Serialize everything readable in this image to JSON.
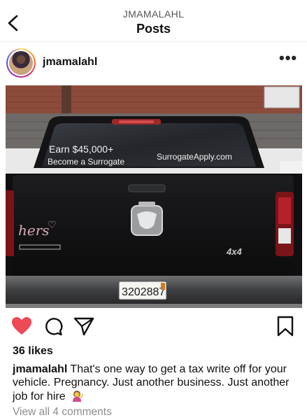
{
  "header": {
    "account_label": "JMAMALAHL",
    "title": "Posts"
  },
  "post": {
    "username": "jmamalahl",
    "more_label": "•••",
    "image": {
      "window_text_line1": "Earn $45,000+",
      "window_text_line2": "Become a Surrogate",
      "window_text_url": "SurrogateApply.com",
      "decal_script": "hers",
      "badge_text": "4x4",
      "plate_text": "3202887"
    },
    "likes": "36 likes",
    "caption_username": "jmamalahl",
    "caption_text": "That's one way to get a tax write off for your vehicle. Pregnancy. Just another business. Just another job for hire",
    "caption_emoji": "woman-tipping-hand-emoji",
    "view_comments": "View all 4 comments"
  },
  "icons": {
    "back": "chevron-left-icon",
    "like": "heart-filled-icon",
    "comment": "comment-bubble-icon",
    "share": "paper-plane-icon",
    "save": "bookmark-icon"
  },
  "colors": {
    "like_red": "#ed4956",
    "muted_text": "#8e8e8e"
  }
}
